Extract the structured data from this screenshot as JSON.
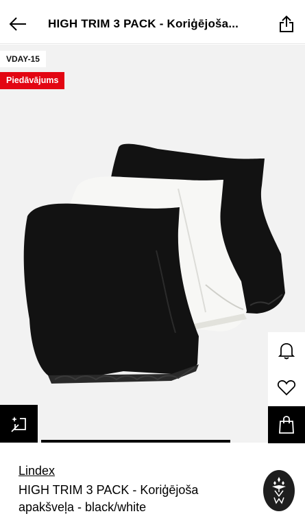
{
  "header": {
    "title": "HIGH TRIM 3 PACK - Koriģējoša..."
  },
  "badges": {
    "code": "VDAY-15",
    "offer": "Piedāvājums",
    "offer_color": "#e30613"
  },
  "icons": {
    "back": "arrow-left-icon",
    "share": "share-icon",
    "notify": "bell-icon",
    "wishlist": "heart-icon",
    "cart": "shopping-bag-icon",
    "size": "size-guide-icon"
  },
  "product": {
    "brand": "Lindex",
    "name": "HIGH TRIM 3 PACK - Koriģējoša apakšveļa - black/white",
    "colors": [
      "#121212",
      "#f7f7f5",
      "#121212"
    ]
  }
}
